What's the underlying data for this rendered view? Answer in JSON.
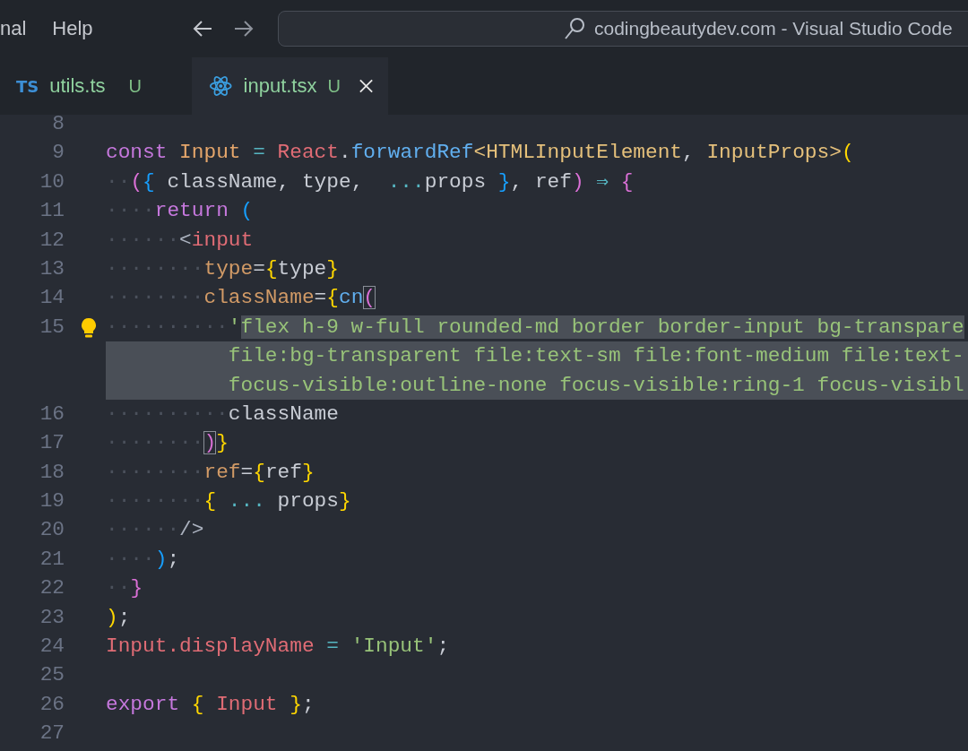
{
  "menu": [
    "nal",
    "Help"
  ],
  "command_center": {
    "text": "codingbeautydev.com - Visual Studio Code"
  },
  "tabs": [
    {
      "kind": "typescript",
      "icon_text": "TS",
      "label": "utils.ts",
      "status": "U",
      "selected": false
    },
    {
      "kind": "react",
      "label": "input.tsx",
      "status": "U",
      "selected": true
    }
  ],
  "editor": {
    "lines": [
      {
        "number": "8",
        "lightbulb": false
      },
      {
        "number": "9",
        "lightbulb": false,
        "tokens": [
          {
            "kind": "keyword",
            "text": "const"
          },
          {
            "kind": "const-name",
            "text": " Input"
          },
          {
            "kind": "operator",
            "text": " ="
          },
          {
            "kind": "object",
            "text": " React"
          },
          {
            "kind": "plain",
            "text": "."
          },
          {
            "kind": "function",
            "text": "forwardRef"
          },
          {
            "kind": "type",
            "text": "<HTMLInputElement"
          },
          {
            "kind": "plain",
            "text": ","
          },
          {
            "kind": "type",
            "text": " InputProps>"
          },
          {
            "kind": "bracket-1",
            "text": "("
          }
        ]
      },
      {
        "number": "10",
        "lightbulb": false,
        "tokens": [
          {
            "kind": "indent",
            "text": "··"
          },
          {
            "kind": "bracket-2",
            "text": "("
          },
          {
            "kind": "bracket-3",
            "text": "{"
          },
          {
            "kind": "plain",
            "text": " className, type, "
          },
          {
            "kind": "operator",
            "text": " ..."
          },
          {
            "kind": "plain",
            "text": "props"
          },
          {
            "kind": "bracket-3",
            "text": " }"
          },
          {
            "kind": "plain",
            "text": ", ref"
          },
          {
            "kind": "bracket-2",
            "text": ")"
          },
          {
            "kind": "operator",
            "text": " ⇒"
          },
          {
            "kind": "bracket-2",
            "text": " {"
          }
        ]
      },
      {
        "number": "11",
        "lightbulb": false,
        "tokens": [
          {
            "kind": "indent",
            "text": "····"
          },
          {
            "kind": "keyword",
            "text": "return"
          },
          {
            "kind": "bracket-3",
            "text": " ("
          }
        ]
      },
      {
        "number": "12",
        "lightbulb": false,
        "tokens": [
          {
            "kind": "indent",
            "text": "······"
          },
          {
            "kind": "punct",
            "text": "<"
          },
          {
            "kind": "tag",
            "text": "input"
          }
        ]
      },
      {
        "number": "13",
        "lightbulb": false,
        "tokens": [
          {
            "kind": "indent",
            "text": "········"
          },
          {
            "kind": "attr",
            "text": "type"
          },
          {
            "kind": "plain",
            "text": "="
          },
          {
            "kind": "bracket-1",
            "text": "{"
          },
          {
            "kind": "plain",
            "text": "type"
          },
          {
            "kind": "bracket-1",
            "text": "}"
          }
        ]
      },
      {
        "number": "14",
        "lightbulb": false,
        "tokens": [
          {
            "kind": "indent",
            "text": "········"
          },
          {
            "kind": "attr",
            "text": "className"
          },
          {
            "kind": "plain",
            "text": "="
          },
          {
            "kind": "bracket-1",
            "text": "{"
          },
          {
            "kind": "function",
            "text": "cn"
          },
          {
            "kind": "bracket-match",
            "text": "("
          }
        ]
      },
      {
        "number": "15",
        "lightbulb": true,
        "rows": [
          {
            "tokens": [
              {
                "kind": "indent",
                "text": "··········",
                "selected": false
              },
              {
                "kind": "string",
                "text": "'",
                "selected": false
              },
              {
                "kind": "string",
                "text": "flex h-9 w-full rounded-md border border-input bg-transpare",
                "selected": true
              }
            ]
          },
          {
            "tokens": [
              {
                "kind": "string",
                "text": "file:bg-transparent file:text-sm file:font-medium file:text-",
                "selected": true
              }
            ]
          },
          {
            "tokens": [
              {
                "kind": "string",
                "text": "focus-visible:outline-none focus-visible:ring-1 focus-visibl",
                "selected": true
              }
            ]
          }
        ]
      },
      {
        "number": "16",
        "lightbulb": false,
        "tokens": [
          {
            "kind": "indent",
            "text": "··········"
          },
          {
            "kind": "plain",
            "text": "className"
          }
        ]
      },
      {
        "number": "17",
        "lightbulb": false,
        "tokens": [
          {
            "kind": "indent",
            "text": "········"
          },
          {
            "kind": "bracket-match",
            "text": ")"
          },
          {
            "kind": "bracket-1",
            "text": "}"
          }
        ]
      },
      {
        "number": "18",
        "lightbulb": false,
        "tokens": [
          {
            "kind": "indent",
            "text": "········"
          },
          {
            "kind": "attr",
            "text": "ref"
          },
          {
            "kind": "plain",
            "text": "="
          },
          {
            "kind": "bracket-1",
            "text": "{"
          },
          {
            "kind": "plain",
            "text": "ref"
          },
          {
            "kind": "bracket-1",
            "text": "}"
          }
        ]
      },
      {
        "number": "19",
        "lightbulb": false,
        "tokens": [
          {
            "kind": "indent",
            "text": "········"
          },
          {
            "kind": "bracket-1",
            "text": "{"
          },
          {
            "kind": "operator",
            "text": " ..."
          },
          {
            "kind": "plain",
            "text": " props"
          },
          {
            "kind": "bracket-1",
            "text": "}"
          }
        ]
      },
      {
        "number": "20",
        "lightbulb": false,
        "tokens": [
          {
            "kind": "indent",
            "text": "······"
          },
          {
            "kind": "punct",
            "text": "/>"
          }
        ]
      },
      {
        "number": "21",
        "lightbulb": false,
        "tokens": [
          {
            "kind": "indent",
            "text": "····"
          },
          {
            "kind": "bracket-3",
            "text": ")"
          },
          {
            "kind": "plain",
            "text": ";"
          }
        ]
      },
      {
        "number": "22",
        "lightbulb": false,
        "tokens": [
          {
            "kind": "indent",
            "text": "··"
          },
          {
            "kind": "bracket-2",
            "text": "}"
          }
        ]
      },
      {
        "number": "23",
        "lightbulb": false,
        "tokens": [
          {
            "kind": "bracket-1",
            "text": ")"
          },
          {
            "kind": "plain",
            "text": ";"
          }
        ]
      },
      {
        "number": "24",
        "lightbulb": false,
        "tokens": [
          {
            "kind": "object",
            "text": "Input.displayName"
          },
          {
            "kind": "operator",
            "text": " ="
          },
          {
            "kind": "string",
            "text": " 'Input'"
          },
          {
            "kind": "plain",
            "text": ";"
          }
        ]
      },
      {
        "number": "25",
        "lightbulb": false
      },
      {
        "number": "26",
        "lightbulb": false,
        "tokens": [
          {
            "kind": "keyword",
            "text": "export"
          },
          {
            "kind": "bracket-1",
            "text": " {"
          },
          {
            "kind": "object",
            "text": " Input"
          },
          {
            "kind": "bracket-1",
            "text": " }"
          },
          {
            "kind": "plain",
            "text": ";"
          }
        ]
      },
      {
        "number": "27",
        "lightbulb": false
      }
    ]
  }
}
